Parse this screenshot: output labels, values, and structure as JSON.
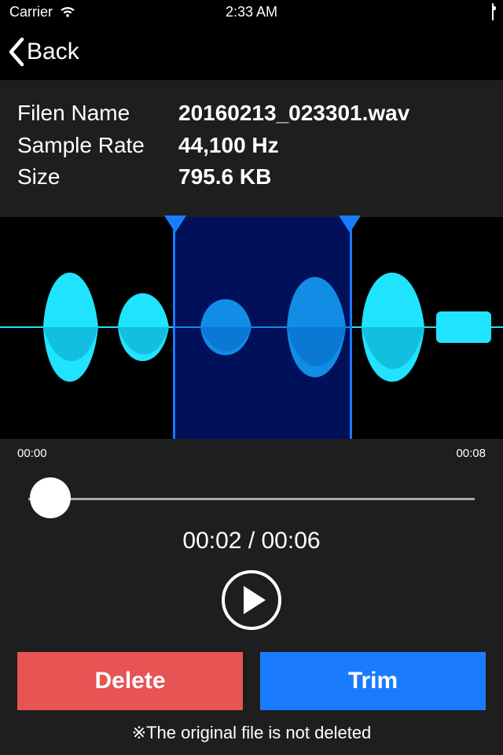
{
  "status": {
    "carrier": "Carrier",
    "time": "2:33 AM"
  },
  "nav": {
    "back_label": "Back"
  },
  "info": {
    "filename_label": "Filen Name",
    "filename_value": "20160213_023301.wav",
    "samplerate_label": "Sample Rate",
    "samplerate_value": "44,100 Hz",
    "size_label": "Size",
    "size_value": "795.6 KB"
  },
  "times": {
    "start": "00:00",
    "end": "00:08"
  },
  "selection_time": "00:02  /  00:06",
  "buttons": {
    "delete": "Delete",
    "trim": "Trim"
  },
  "footer": "※The original file is not deleted"
}
